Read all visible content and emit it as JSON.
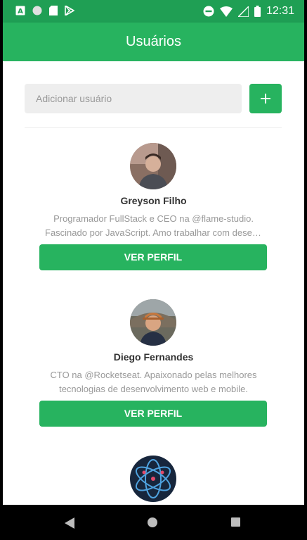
{
  "status_bar": {
    "time": "12:31",
    "icons": [
      "a-badge-icon",
      "circle-icon",
      "sd-card-icon",
      "play-store-icon",
      "do-not-disturb-icon",
      "wifi-icon",
      "signal-icon",
      "battery-icon"
    ]
  },
  "app_bar": {
    "title": "Usuários"
  },
  "add_user": {
    "placeholder": "Adicionar usuário",
    "button_symbol": "+"
  },
  "users": [
    {
      "name": "Greyson Filho",
      "bio_line1": "Programador FullStack e CEO na @flame-studio.",
      "bio_line2": "Fascinado por JavaScript. Amo trabalhar com desen...",
      "button_label": "VER PERFIL"
    },
    {
      "name": "Diego Fernandes",
      "bio_line1": "CTO na @Rocketseat. Apaixonado pelas melhores",
      "bio_line2": "tecnologias de desenvolvimento web e mobile.",
      "button_label": "VER PERFIL"
    }
  ],
  "colors": {
    "primary": "#27b35f",
    "status_bar": "#1f9f54",
    "input_bg": "#eeeeee",
    "name": "#333333",
    "bio": "#999999"
  }
}
